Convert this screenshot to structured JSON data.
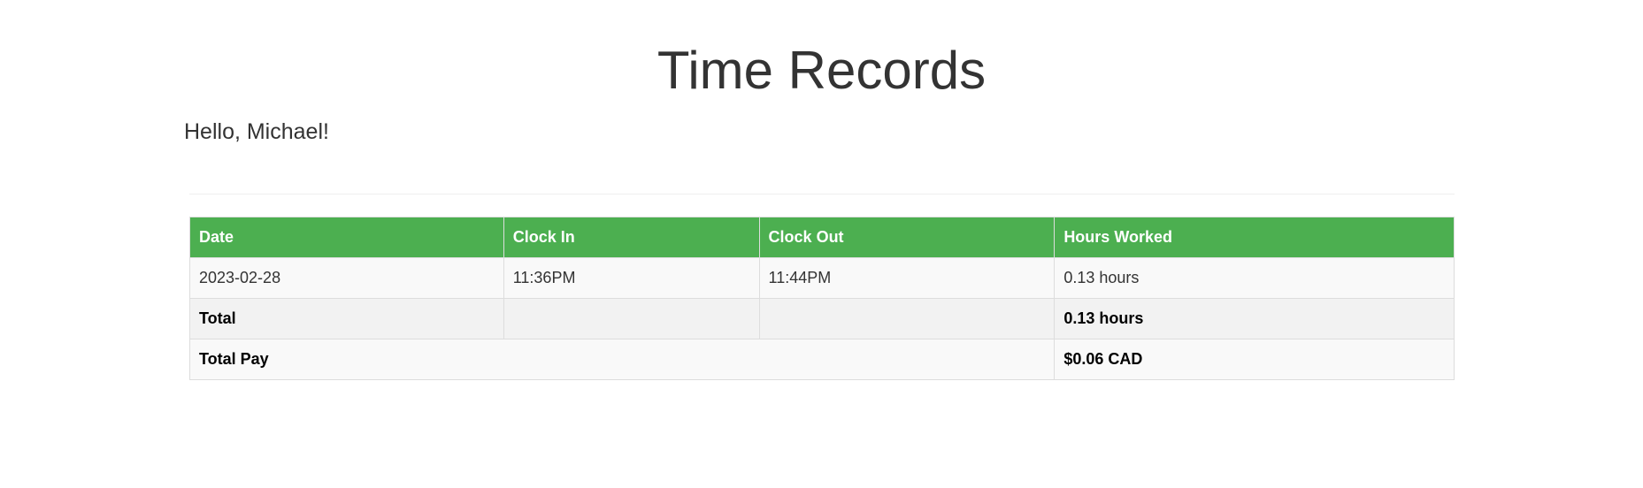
{
  "page": {
    "title": "Time Records",
    "greeting": "Hello, Michael!"
  },
  "table": {
    "headers": [
      "Date",
      "Clock In",
      "Clock Out",
      "Hours Worked"
    ],
    "rows": [
      {
        "date": "2023-02-28",
        "clock_in": "11:36PM",
        "clock_out": "11:44PM",
        "hours": "0.13 hours"
      }
    ],
    "total": {
      "label": "Total",
      "hours": "0.13 hours"
    },
    "total_pay": {
      "label": "Total Pay",
      "amount": "$0.06 CAD"
    }
  },
  "colors": {
    "header_bg": "#4caf50",
    "header_text": "#ffffff"
  }
}
